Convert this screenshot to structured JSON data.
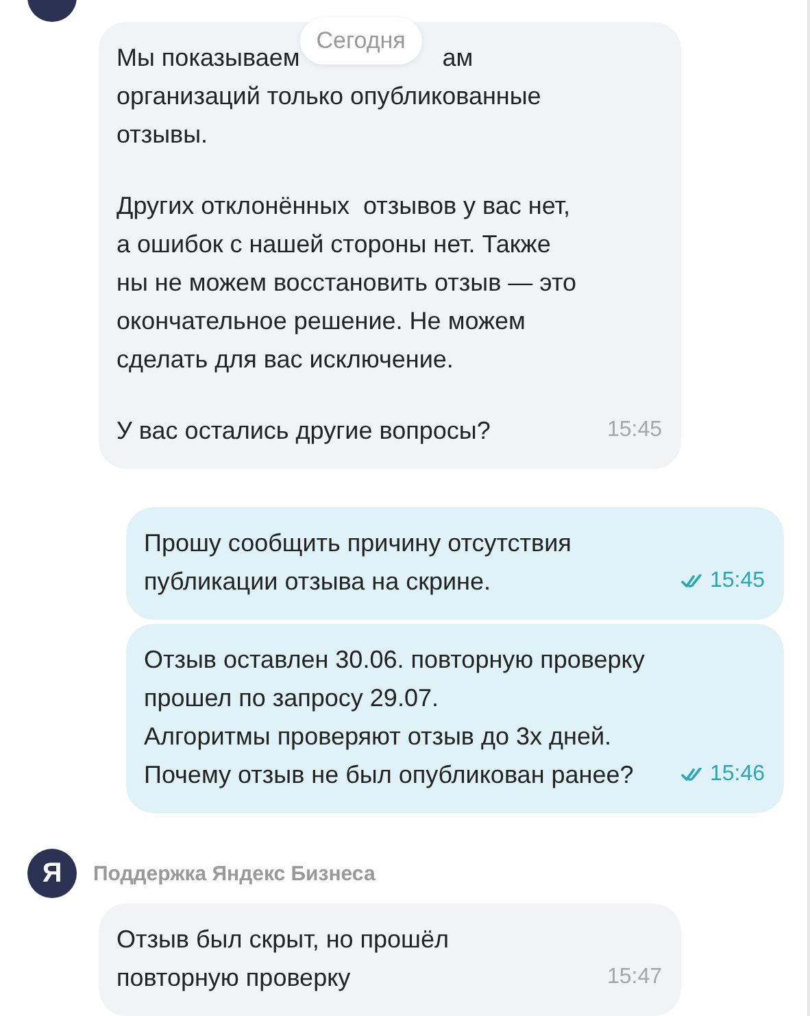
{
  "date_label": "Сегодня",
  "items": [
    {
      "kind": "sender_partial"
    },
    {
      "kind": "incoming",
      "first_line_parts": [
        "Мы показываем",
        "ам"
      ],
      "paragraphs": [
        "организаций только опубликованные\nотзывы.",
        "Других отклонённых  отзывов у вас нет,\nа ошибок с нашей стороны нет. Также\nны не можем восстановить отзыв — это\nокончательное решение. Не можем\nсделать для вас исключение.",
        "У вас остались другие вопросы?"
      ],
      "time": "15:45"
    },
    {
      "kind": "outgoing",
      "paragraphs": [
        "Прошу сообщить причину отсутствия\nпубликации отзыва на скрине."
      ],
      "time": "15:45",
      "read": true
    },
    {
      "kind": "outgoing",
      "paragraphs": [
        "Отзыв оставлен 30.06. повторную проверку\nпрошел по запросу 29.07.\nАлгоритмы проверяют отзыв до 3х дней.\nПочему отзыв не был опубликован ранее?"
      ],
      "time": "15:46",
      "read": true
    },
    {
      "kind": "sender",
      "name": "Поддержка Яндекс Бизнеса",
      "avatar_letter": "Я"
    },
    {
      "kind": "incoming",
      "paragraphs": [
        "Отзыв был скрыт, но прошёл\nповторную проверку"
      ],
      "time": "15:47"
    }
  ]
}
